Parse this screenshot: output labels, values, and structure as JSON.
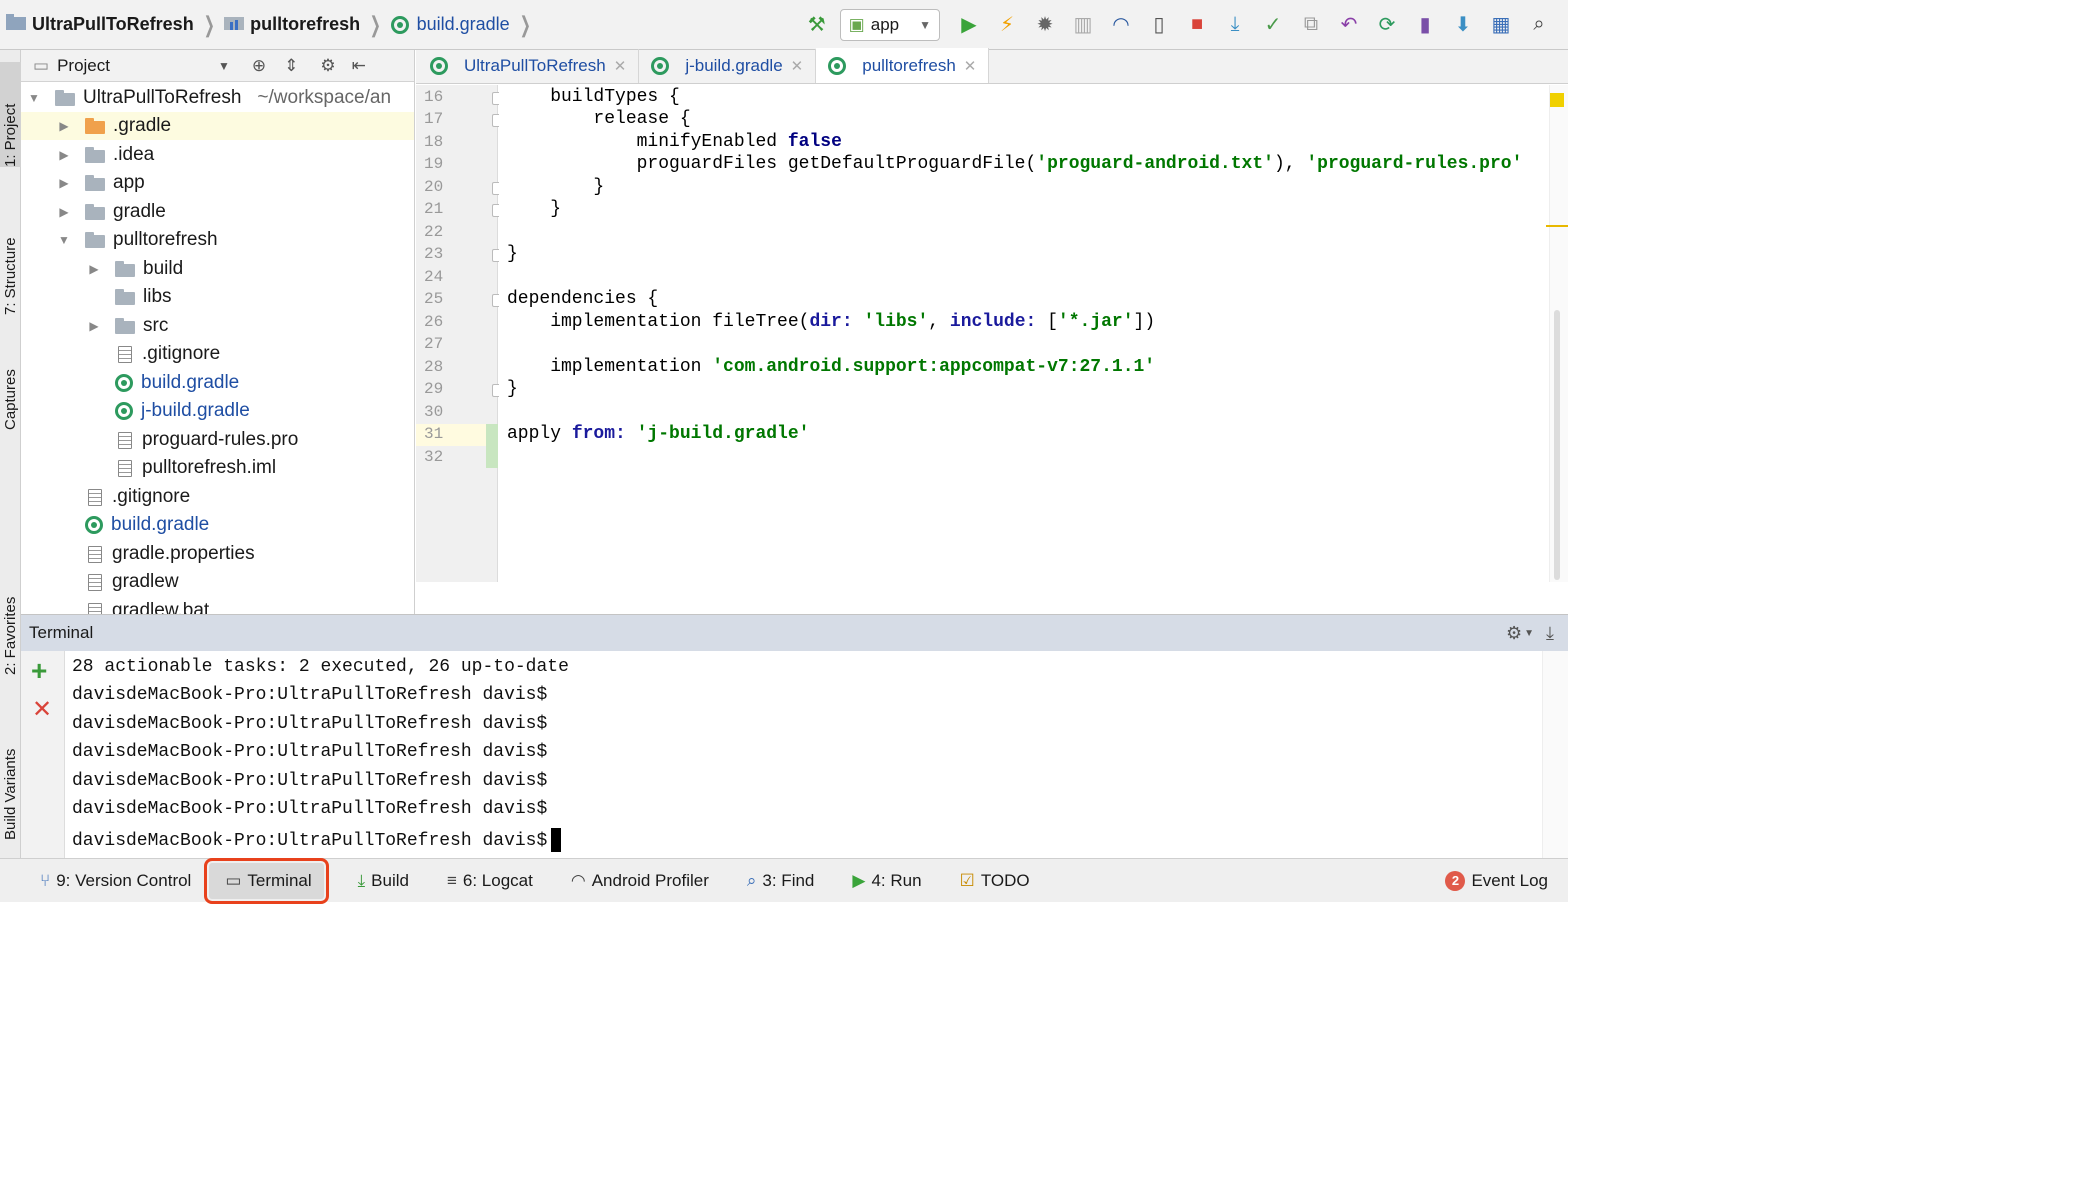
{
  "breadcrumbs": [
    "UltraPullToRefresh",
    "pulltorefresh",
    "build.gradle"
  ],
  "toolbar": {
    "run_config": "app"
  },
  "left_tabs": [
    "1: Project",
    "7: Structure",
    "Captures",
    "2: Favorites",
    "Build Variants"
  ],
  "project_panel": {
    "title": "Project",
    "root": {
      "name": "UltraPullToRefresh",
      "path": "~/workspace/an"
    },
    "items": [
      {
        "label": ".gradle"
      },
      {
        "label": ".idea"
      },
      {
        "label": "app"
      },
      {
        "label": "gradle"
      },
      {
        "label": "pulltorefresh"
      },
      {
        "label": "build"
      },
      {
        "label": "libs"
      },
      {
        "label": "src"
      },
      {
        "label": ".gitignore"
      },
      {
        "label": "build.gradle"
      },
      {
        "label": "j-build.gradle"
      },
      {
        "label": "proguard-rules.pro"
      },
      {
        "label": "pulltorefresh.iml"
      },
      {
        "label": ".gitignore"
      },
      {
        "label": "build.gradle"
      },
      {
        "label": "gradle.properties"
      },
      {
        "label": "gradlew"
      },
      {
        "label": "gradlew.bat"
      }
    ]
  },
  "editor_tabs": [
    {
      "label": "UltraPullToRefresh"
    },
    {
      "label": "j-build.gradle"
    },
    {
      "label": "pulltorefresh"
    }
  ],
  "editor": {
    "line_numbers": [
      "16",
      "17",
      "18",
      "19",
      "20",
      "21",
      "22",
      "23",
      "24",
      "25",
      "26",
      "27",
      "28",
      "29",
      "30",
      "31",
      "32"
    ],
    "tokens": {
      "l16": "    buildTypes {",
      "l17": "        release {",
      "l18a": "            minifyEnabled ",
      "l18b": "false",
      "l19a": "            proguardFiles getDefaultProguardFile(",
      "l19b": "'proguard-android.txt'",
      "l19c": "), ",
      "l19d": "'proguard-rules.pro'",
      "l20": "        }",
      "l21": "    }",
      "l23": "}",
      "l25": "dependencies {",
      "l26a": "    implementation fileTree(",
      "l26b": "dir: ",
      "l26c": "'libs'",
      "l26d": ", ",
      "l26e": "include: ",
      "l26f": "[",
      "l26g": "'*.jar'",
      "l26h": "])",
      "l28a": "    implementation ",
      "l28b": "'com.android.support:appcompat-v7:27.1.1'",
      "l29": "}",
      "l31a": "apply ",
      "l31b": "from: ",
      "l31c": "'j-build.gradle'"
    }
  },
  "terminal": {
    "title": "Terminal",
    "lines": [
      "28 actionable tasks: 2 executed, 26 up-to-date",
      "davisdeMacBook-Pro:UltraPullToRefresh davis$",
      "davisdeMacBook-Pro:UltraPullToRefresh davis$",
      "davisdeMacBook-Pro:UltraPullToRefresh davis$",
      "davisdeMacBook-Pro:UltraPullToRefresh davis$",
      "davisdeMacBook-Pro:UltraPullToRefresh davis$",
      "davisdeMacBook-Pro:UltraPullToRefresh davis$"
    ]
  },
  "bottom_tabs": [
    {
      "label": "9: Version Control"
    },
    {
      "label": "Terminal"
    },
    {
      "label": "Build"
    },
    {
      "label": "6: Logcat"
    },
    {
      "label": "Android Profiler"
    },
    {
      "label": "3: Find"
    },
    {
      "label": "4: Run"
    },
    {
      "label": "TODO"
    }
  ],
  "event_log": {
    "label": "Event Log",
    "count": "2"
  },
  "colors": {
    "accent": "#1f4ea3",
    "string": "#007700",
    "keyword": "#000080",
    "highlight": "#e8411c"
  }
}
